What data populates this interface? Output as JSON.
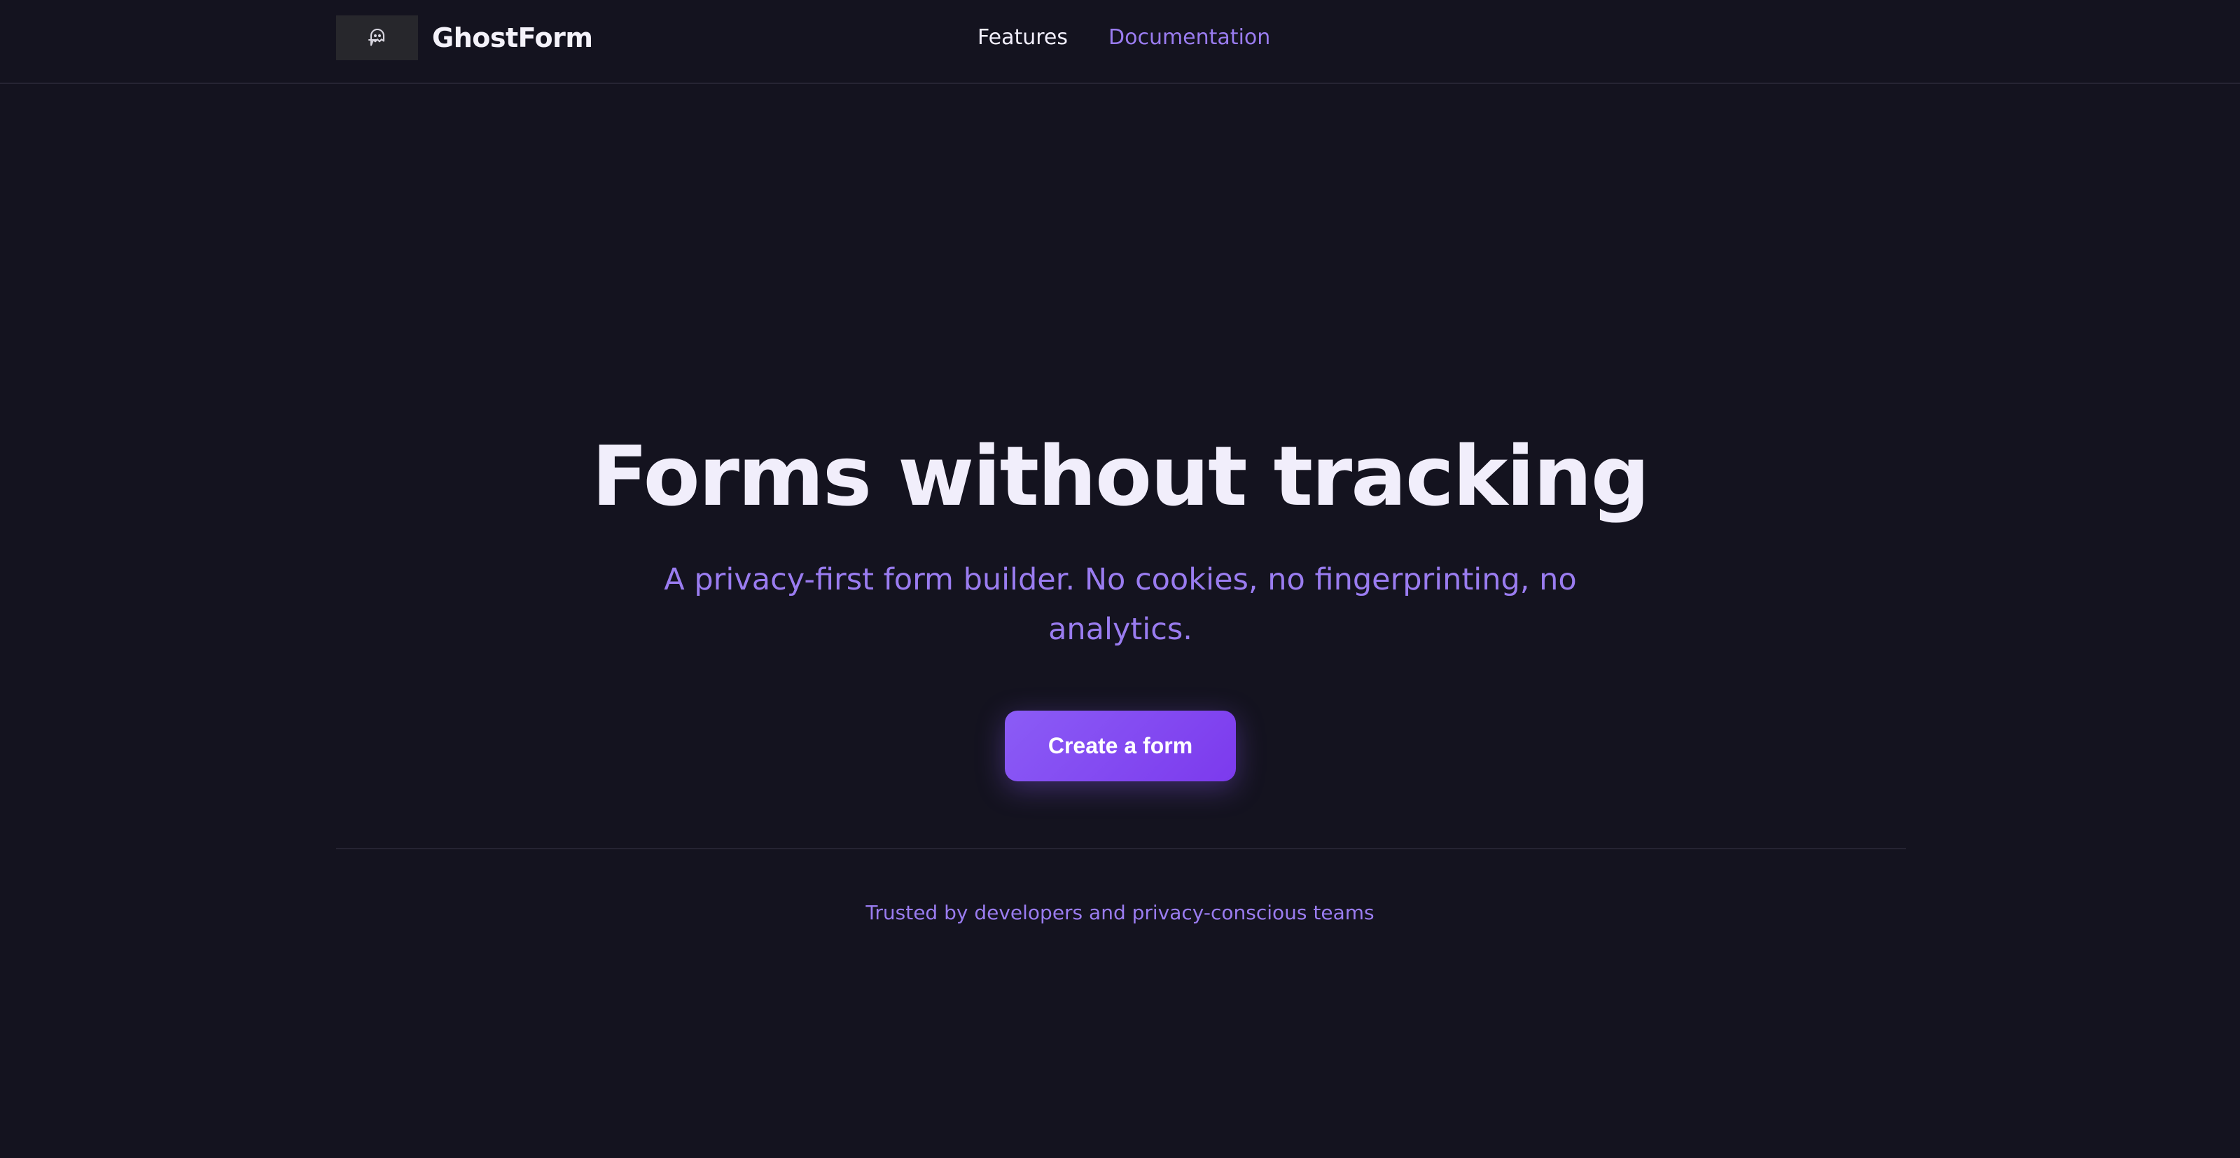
{
  "header": {
    "brand": "GhostForm",
    "logo_icon": "ghost-icon",
    "nav": {
      "features_label": "Features",
      "documentation_label": "Documentation"
    }
  },
  "hero": {
    "title": "Forms without tracking",
    "subtitle": "A privacy-first form builder. No cookies, no fingerprinting, no analytics.",
    "cta_label": "Create a form"
  },
  "social_proof": {
    "text": "Trusted by developers and privacy-conscious teams"
  },
  "colors": {
    "background": "#14131f",
    "accent": "#9a7cf0",
    "button_gradient_start": "#8b5cf6",
    "button_gradient_end": "#7c3aed",
    "text_primary": "#f1eefb"
  }
}
